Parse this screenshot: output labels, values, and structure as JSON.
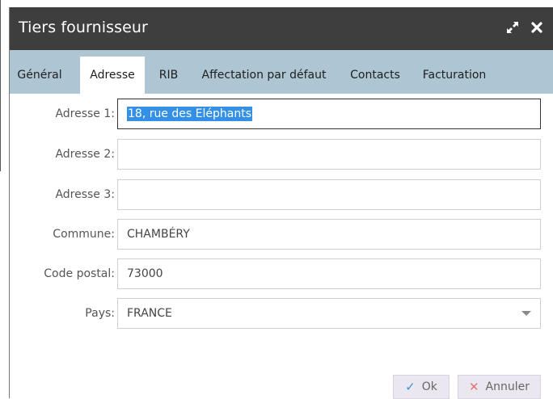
{
  "dialog": {
    "title": "Tiers fournisseur"
  },
  "tabs": [
    {
      "label": "Général"
    },
    {
      "label": "Adresse"
    },
    {
      "label": "RIB"
    },
    {
      "label": "Affectation par défaut"
    },
    {
      "label": "Contacts"
    },
    {
      "label": "Facturation"
    }
  ],
  "active_tab": "Adresse",
  "form": {
    "adresse1": {
      "label": "Adresse 1:",
      "value": "18, rue des Eléphants"
    },
    "adresse2": {
      "label": "Adresse 2:",
      "value": ""
    },
    "adresse3": {
      "label": "Adresse 3:",
      "value": ""
    },
    "commune": {
      "label": "Commune:",
      "value": "CHAMBÉRY"
    },
    "code_postal": {
      "label": "Code postal:",
      "value": "73000"
    },
    "pays": {
      "label": "Pays:",
      "value": "FRANCE"
    }
  },
  "buttons": {
    "ok_label": "Ok",
    "cancel_label": "Annuler"
  },
  "icons": {
    "maximize": "expand-arrows-icon",
    "close": "close-x-icon",
    "ok": "checkmark-icon",
    "cancel": "cross-icon"
  },
  "colors": {
    "titlebar": "#3e3e3e",
    "tabbar": "#aec6d3",
    "selection": "#3390e6",
    "ok_icon": "#3b8fd6",
    "cancel_icon": "#e57373",
    "button_bg": "#ebe7f1"
  }
}
